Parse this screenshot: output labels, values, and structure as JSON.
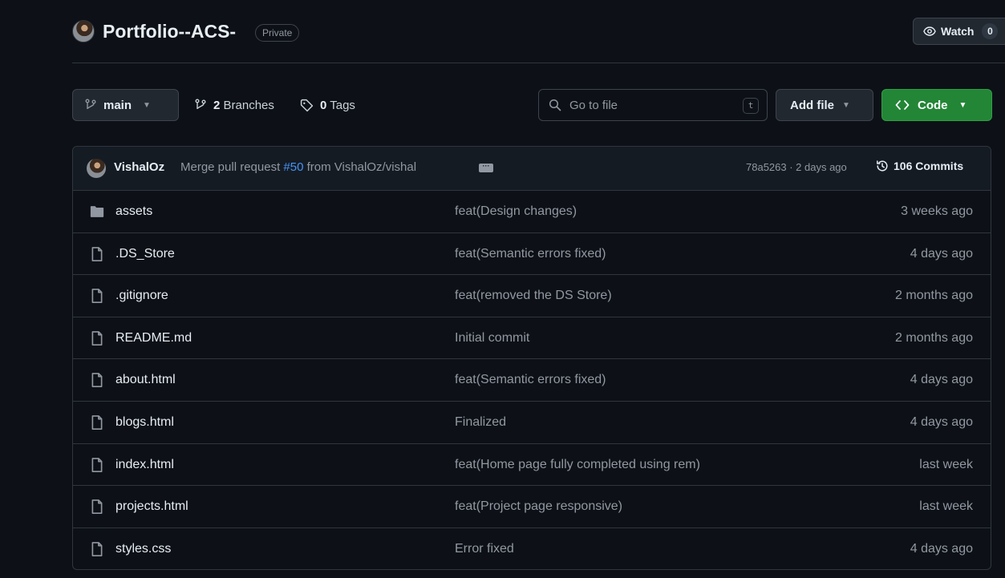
{
  "repo": {
    "name": "Portfolio--ACS-",
    "visibility": "Private",
    "watch_label": "Watch",
    "watch_count": "0"
  },
  "toolbar": {
    "branch": "main",
    "branches_count": "2",
    "branches_label": "Branches",
    "tags_count": "0",
    "tags_label": "Tags",
    "search_placeholder": "Go to file",
    "search_shortcut": "t",
    "add_file_label": "Add file",
    "code_label": "Code"
  },
  "latest_commit": {
    "author": "VishalOz",
    "message_prefix": "Merge pull request",
    "pr_number": "#50",
    "message_suffix": "from VishalOz/vishal",
    "hash_time": "78a5263 · 2 days ago",
    "commits_label": "106 Commits"
  },
  "files": [
    {
      "name": "assets",
      "type": "folder",
      "message": "feat(Design changes)",
      "date": "3 weeks ago"
    },
    {
      "name": ".DS_Store",
      "type": "file",
      "message": "feat(Semantic errors fixed)",
      "date": "4 days ago"
    },
    {
      "name": ".gitignore",
      "type": "file",
      "message": "feat(removed the DS Store)",
      "date": "2 months ago"
    },
    {
      "name": "README.md",
      "type": "file",
      "message": "Initial commit",
      "date": "2 months ago"
    },
    {
      "name": "about.html",
      "type": "file",
      "message": "feat(Semantic errors fixed)",
      "date": "4 days ago"
    },
    {
      "name": "blogs.html",
      "type": "file",
      "message": "Finalized",
      "date": "4 days ago"
    },
    {
      "name": "index.html",
      "type": "file",
      "message": "feat(Home page fully completed using rem)",
      "date": "last week"
    },
    {
      "name": "projects.html",
      "type": "file",
      "message": "feat(Project page responsive)",
      "date": "last week"
    },
    {
      "name": "styles.css",
      "type": "file",
      "message": "Error fixed",
      "date": "4 days ago"
    }
  ],
  "colors": {
    "background": "#0d1117",
    "accent_green": "#238636",
    "link_blue": "#4493f8",
    "muted_text": "#9198a1",
    "border": "#30363d"
  }
}
